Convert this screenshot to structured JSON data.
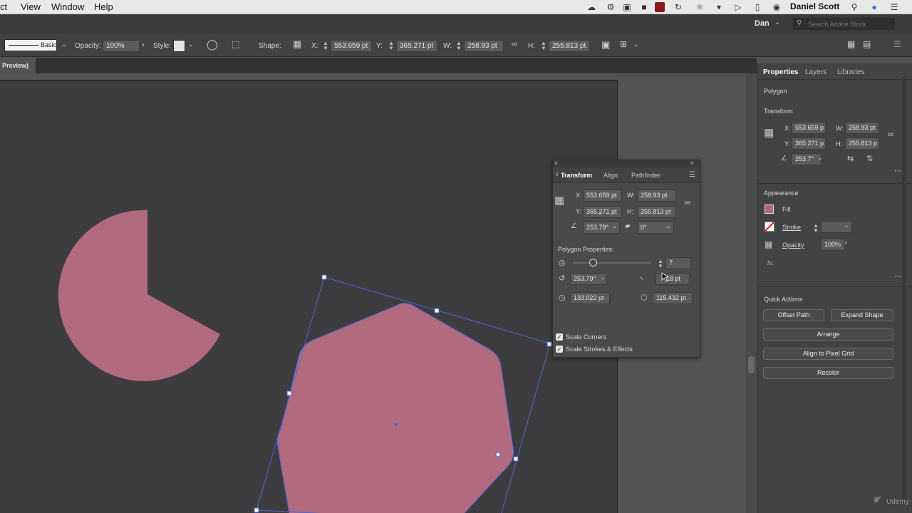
{
  "menubar": {
    "items": [
      "ct",
      "View",
      "Window",
      "Help"
    ],
    "user": "Daniel Scott"
  },
  "appbar": {
    "workspace_user": "Dan",
    "search_placeholder": "Search Adobe Stock"
  },
  "control": {
    "stroke_style": "Basic",
    "opacity_label": "Opacity:",
    "opacity_value": "100%",
    "style_label": "Style:",
    "shape_label": "Shape:",
    "x_label": "X:",
    "x_value": "553.659 pt",
    "y_label": "Y:",
    "y_value": "365.271 pt",
    "w_label": "W:",
    "w_value": "258.93 pt",
    "h_label": "H:",
    "h_value": "255.813 pt"
  },
  "document_tab": "Preview)",
  "properties_panel": {
    "tabs": [
      "Properties",
      "Layers",
      "Libraries"
    ],
    "object_type": "Polygon",
    "transform_title": "Transform",
    "x_label": "X:",
    "x_value": "553.659 p",
    "y_label": "Y:",
    "y_value": "365.271 p",
    "w_label": "W:",
    "w_value": "258.93 pt",
    "h_label": "H:",
    "h_value": "255.813 p",
    "angle_value": "253.7°",
    "appearance_title": "Appearance",
    "fill_label": "Fill",
    "stroke_label": "Stroke",
    "opacity_label": "Opacity",
    "opacity_value": "100%",
    "fx_label": "fx.",
    "quick_actions_title": "Quick Actions",
    "buttons": {
      "offset_path": "Offset Path",
      "expand_shape": "Expand Shape",
      "arrange": "Arrange",
      "align_pixel_grid": "Align to Pixel Grid",
      "recolor": "Recolor"
    }
  },
  "transform_panel": {
    "tabs": [
      "Transform",
      "Align",
      "Pathfinder"
    ],
    "x_label": "X:",
    "x_value": "553.659 pt",
    "y_label": "Y:",
    "y_value": "365.271 pt",
    "w_label": "W:",
    "w_value": "258.93 pt",
    "h_label": "H:",
    "h_value": "255.813 pt",
    "rotate_value": "253.79°",
    "shear_value": "0°",
    "polygon_properties_title": "Polygon Properties:",
    "sides_value": "7",
    "sides_fraction": 0.25,
    "polygon_angle": "253.79°",
    "corner_radius": "18 pt",
    "radius_value": "133.022 pt",
    "side_length": "115.432 pt",
    "scale_corners_label": "Scale Corners",
    "scale_strokes_label": "Scale Strokes & Effects"
  },
  "watermark": "Udemy",
  "colors": {
    "fill": "#b26a7e",
    "selection": "#4a67d6",
    "menubar": "#e8e8e8",
    "panel": "#434343"
  }
}
